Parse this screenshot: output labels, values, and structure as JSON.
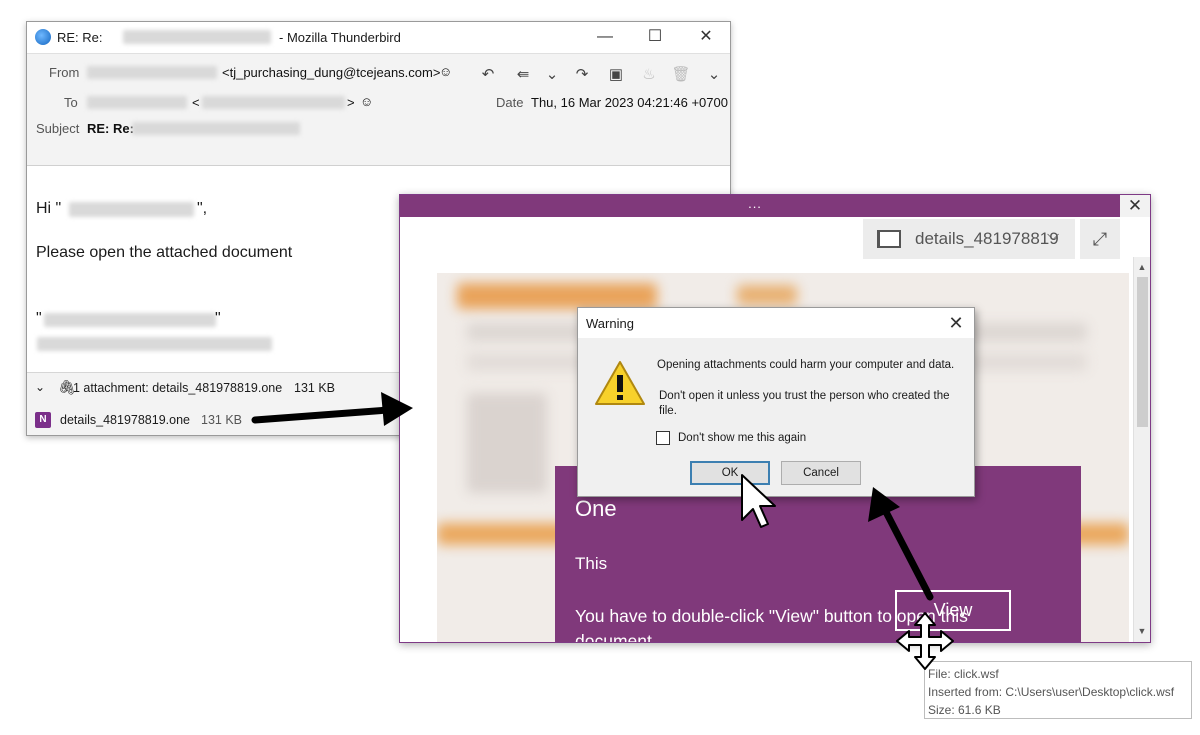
{
  "thunderbird": {
    "title_prefix": "RE: Re:",
    "title_app": "- Mozilla Thunderbird",
    "from_label": "From",
    "from_email": "<tj_purchasing_dung@tcejeans.com>",
    "to_label": "To",
    "to_bracket_open": "<",
    "to_bracket_close": ">",
    "date_label": "Date",
    "date_value": "Thu, 16 Mar 2023 04:21:46 +0700",
    "subject_label": "Subject",
    "subject_prefix": "RE: Re:",
    "greeting_start": "Hi \"",
    "greeting_end": "\",",
    "body_line": "Please open the attached document",
    "sig_open": "\"",
    "sig_close": "\"",
    "attachment_summary": "1 attachment: details_481978819.one",
    "attachment_summary_size": "131 KB",
    "attachment_name": "details_481978819.one",
    "attachment_size": "131 KB"
  },
  "onenote": {
    "dots": "...",
    "notebook_name": "details_481978819",
    "page_heading": "One",
    "page_line2": "This",
    "page_instruction": "You have to double-click \"View\" button to open this document.",
    "view_button": "View"
  },
  "dialog": {
    "title": "Warning",
    "message1": "Opening attachments could harm your computer and data.",
    "message2": "Don't open it unless you trust the person who created the file.",
    "checkbox_label": "Don't show me this again",
    "ok": "OK",
    "cancel": "Cancel"
  },
  "tooltip": {
    "file": "File: click.wsf",
    "inserted": "Inserted from: C:\\Users\\user\\Desktop\\click.wsf",
    "size": "Size: 61.6 KB"
  },
  "icons": {
    "tb_logo": "thunderbird-logo-icon",
    "minimize": "minimize-icon",
    "maximize": "maximize-icon",
    "close": "close-icon",
    "contact": "contact-icon",
    "reply": "reply-icon",
    "reply_all": "reply-all-icon",
    "forward": "forward-icon",
    "archive": "archive-icon",
    "junk": "junk-icon",
    "delete": "trash-icon",
    "more": "chevron-down-icon",
    "paperclip": "paperclip-icon",
    "onenote_file": "onenote-file-icon",
    "warning": "warning-triangle-icon",
    "move_cursor": "move-cursor-icon",
    "pointer_cursor": "pointer-cursor-icon"
  },
  "colors": {
    "onenote_purple": "#80397b",
    "dialog_bg": "#f0f0f0",
    "ok_border": "#3c7fb1"
  }
}
